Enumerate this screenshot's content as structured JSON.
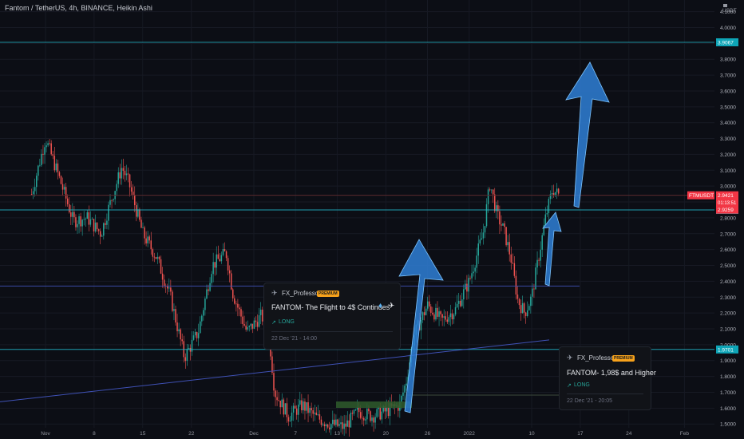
{
  "header": {
    "symbol_title": "Fantom / TetherUS, 4h, BINANCE, Heikin Ashi",
    "currency": "USDT"
  },
  "price_tags": {
    "symbol": "FTMUSDT",
    "last_price": "2.9421",
    "countdown": "01:13:51",
    "level_top": "3.9067",
    "level_mid_red": "2.9259",
    "level_mid_cyan": "2.8498",
    "level_low": "1.9701"
  },
  "idea_cards": [
    {
      "author": "FX_Professor",
      "badge": "PREMIUM",
      "title": "FANTOM- The Flight to 4$ Continues",
      "direction": "LONG",
      "timestamp": "22 Dec '21 - 14:00"
    },
    {
      "author": "FX_Professor",
      "badge": "PREMIUM",
      "title": "FANTOM- 1,98$ and Higher",
      "direction": "LONG",
      "timestamp": "22 Dec '21 - 20:05"
    }
  ],
  "colors": {
    "background": "#0c0e15",
    "up_candle": "#26a69a",
    "down_candle": "#ef5350",
    "level_line": "#22b8c9",
    "trend_line": "#3f51b5",
    "arrow_fill": "#2f7fd6",
    "price_tag": "#f23645",
    "level_tag": "#0ea5b7"
  },
  "chart_data": {
    "type": "candlestick",
    "title": "Fantom / TetherUS, 4h, BINANCE, Heikin Ashi",
    "xlabel": "",
    "ylabel": "USDT",
    "ylim": [
      1.45,
      4.15
    ],
    "grid": true,
    "x_ticks": [
      "Nov",
      "8",
      "15",
      "22",
      "Dec",
      "7",
      "13",
      "20",
      "26",
      "2022",
      "10",
      "17",
      "24",
      "Feb"
    ],
    "y_ticks": [
      "4.1000",
      "4.0000",
      "3.9000",
      "3.8000",
      "3.7000",
      "3.6000",
      "3.5000",
      "3.4000",
      "3.3000",
      "3.2000",
      "3.1000",
      "3.0000",
      "2.9000",
      "2.8000",
      "2.7000",
      "2.6000",
      "2.5000",
      "2.4000",
      "2.3000",
      "2.2000",
      "2.1000",
      "2.0000",
      "1.9000",
      "1.8000",
      "1.7000",
      "1.6000",
      "1.5000"
    ],
    "close_path": [
      {
        "t": "2021-10-30",
        "price": 2.95
      },
      {
        "t": "2021-11-01",
        "price": 3.3
      },
      {
        "t": "2021-11-03",
        "price": 3.05
      },
      {
        "t": "2021-11-05",
        "price": 2.78
      },
      {
        "t": "2021-11-07",
        "price": 2.8
      },
      {
        "t": "2021-11-09",
        "price": 2.7
      },
      {
        "t": "2021-11-10",
        "price": 2.85
      },
      {
        "t": "2021-11-12",
        "price": 3.12
      },
      {
        "t": "2021-11-13",
        "price": 3.02
      },
      {
        "t": "2021-11-15",
        "price": 2.7
      },
      {
        "t": "2021-11-17",
        "price": 2.55
      },
      {
        "t": "2021-11-19",
        "price": 2.3
      },
      {
        "t": "2021-11-21",
        "price": 1.92
      },
      {
        "t": "2021-11-23",
        "price": 2.08
      },
      {
        "t": "2021-11-25",
        "price": 2.5
      },
      {
        "t": "2021-11-27",
        "price": 2.58
      },
      {
        "t": "2021-11-28",
        "price": 2.32
      },
      {
        "t": "2021-11-30",
        "price": 2.08
      },
      {
        "t": "2021-12-02",
        "price": 2.18
      },
      {
        "t": "2021-12-03",
        "price": 2.14
      },
      {
        "t": "2021-12-04",
        "price": 1.7
      },
      {
        "t": "2021-12-06",
        "price": 1.55
      },
      {
        "t": "2021-12-08",
        "price": 1.62
      },
      {
        "t": "2021-12-10",
        "price": 1.54
      },
      {
        "t": "2021-12-12",
        "price": 1.5
      },
      {
        "t": "2021-12-14",
        "price": 1.48
      },
      {
        "t": "2021-12-16",
        "price": 1.58
      },
      {
        "t": "2021-12-18",
        "price": 1.55
      },
      {
        "t": "2021-12-20",
        "price": 1.58
      },
      {
        "t": "2021-12-22",
        "price": 1.62
      },
      {
        "t": "2021-12-23",
        "price": 1.78
      },
      {
        "t": "2021-12-24",
        "price": 2.05
      },
      {
        "t": "2021-12-26",
        "price": 2.25
      },
      {
        "t": "2021-12-28",
        "price": 2.15
      },
      {
        "t": "2021-12-30",
        "price": 2.22
      },
      {
        "t": "2022-01-01",
        "price": 2.4
      },
      {
        "t": "2022-01-03",
        "price": 2.7
      },
      {
        "t": "2022-01-04",
        "price": 3.02
      },
      {
        "t": "2022-01-05",
        "price": 2.82
      },
      {
        "t": "2022-01-06",
        "price": 2.72
      },
      {
        "t": "2022-01-07",
        "price": 2.55
      },
      {
        "t": "2022-01-08",
        "price": 2.28
      },
      {
        "t": "2022-01-09",
        "price": 2.2
      },
      {
        "t": "2022-01-10",
        "price": 2.3
      },
      {
        "t": "2022-01-11",
        "price": 2.55
      },
      {
        "t": "2022-01-12",
        "price": 2.8
      },
      {
        "t": "2022-01-13",
        "price": 2.98
      },
      {
        "t": "2022-01-14",
        "price": 2.94
      }
    ],
    "horizontal_levels": [
      3.9067,
      2.8498,
      2.37,
      1.9701
    ],
    "current_price": 2.9421,
    "series": [
      {
        "name": "FTMUSDT",
        "values": [
          2.9421
        ]
      }
    ]
  }
}
